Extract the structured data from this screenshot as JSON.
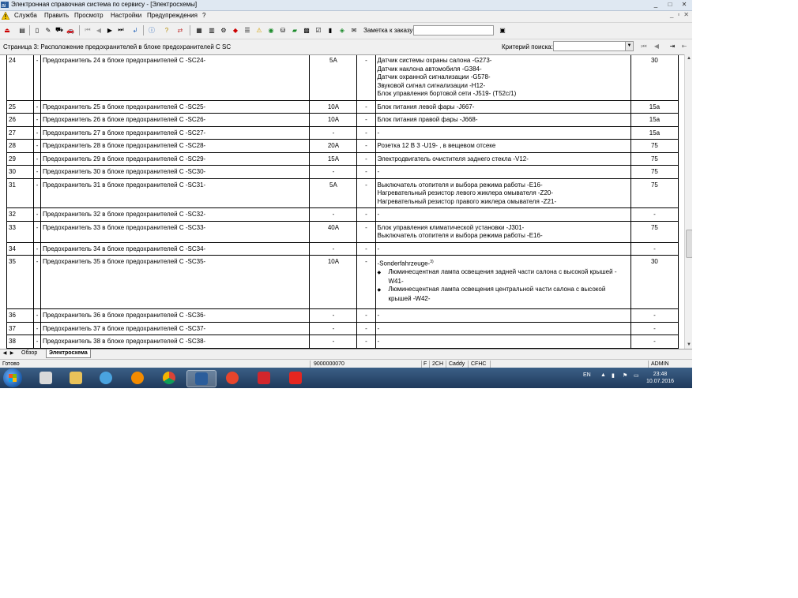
{
  "window": {
    "title": "Электронная справочная система по сервису - [Электросхемы]"
  },
  "menu": {
    "items": [
      "Служба",
      "Править",
      "Просмотр",
      "Настройки",
      "Предупреждения",
      "?"
    ]
  },
  "toolbar": {
    "order_note_label": "Заметка к заказу:",
    "order_note_value": ""
  },
  "page": {
    "title": "Страница 3: Расположение предохранителей в блоке предохранителей С SC",
    "search_label": "Критерий поиска:",
    "search_value": ""
  },
  "table": {
    "rows": [
      {
        "num": "24",
        "dash": "-",
        "name": "Предохранитель 24 в блоке предохранителей С -SC24-",
        "amp": "5A",
        "dash2": "-",
        "desc": [
          "Датчик системы охраны салона -G273-",
          "Датчик наклона автомобиля -G384-",
          "Датчик охранной сигнализации -G578-",
          "Звуковой сигнал сигнализации -H12-",
          "Блок управления бортовой сети -J519- (T52c/1)"
        ],
        "col": "30"
      },
      {
        "num": "25",
        "dash": "-",
        "name": "Предохранитель 25 в блоке предохранителей С -SC25-",
        "amp": "10A",
        "dash2": "-",
        "desc": [
          "Блок питания левой фары -J667-"
        ],
        "col": "15a"
      },
      {
        "num": "26",
        "dash": "-",
        "name": "Предохранитель 26 в блоке предохранителей С -SC26-",
        "amp": "10A",
        "dash2": "-",
        "desc": [
          "Блок питания правой фары -J668-"
        ],
        "col": "15a"
      },
      {
        "num": "27",
        "dash": "-",
        "name": "Предохранитель 27 в блоке предохранителей С -SC27-",
        "amp": "-",
        "dash2": "-",
        "desc": [
          "-"
        ],
        "col": "15a"
      },
      {
        "num": "28",
        "dash": "-",
        "name": "Предохранитель 28 в блоке предохранителей С -SC28-",
        "amp": "20A",
        "dash2": "-",
        "desc": [
          "Розетка 12 В 3 -U19- , в вещевом отсеке"
        ],
        "col": "75"
      },
      {
        "num": "29",
        "dash": "-",
        "name": "Предохранитель 29 в блоке предохранителей С -SC29-",
        "amp": "15A",
        "dash2": "-",
        "desc": [
          "Электродвигатель очистителя заднего стекла -V12-"
        ],
        "col": "75"
      },
      {
        "num": "30",
        "dash": "-",
        "name": "Предохранитель 30 в блоке предохранителей С -SC30-",
        "amp": "-",
        "dash2": "-",
        "desc": [
          "-"
        ],
        "col": "75"
      },
      {
        "num": "31",
        "dash": "-",
        "name": "Предохранитель 31 в блоке предохранителей С -SC31-",
        "amp": "5A",
        "dash2": "-",
        "desc": [
          "Выключатель отопителя и выбора режима работы -E16-",
          "Нагревательный резистор левого жиклера омывателя -Z20-",
          "Нагревательный резистор правого жиклера омывателя -Z21-"
        ],
        "col": "75"
      },
      {
        "num": "32",
        "dash": "-",
        "name": "Предохранитель 32 в блоке предохранителей С -SC32-",
        "amp": "-",
        "dash2": "-",
        "desc": [
          "-"
        ],
        "col": "-"
      },
      {
        "num": "33",
        "dash": "-",
        "name": "Предохранитель 33 в блоке предохранителей С -SC33-",
        "amp": "40A",
        "dash2": "-",
        "desc": [
          "Блок управления климатической установки -J301-",
          "Выключатель отопителя и выбора режима работы -E16-"
        ],
        "col": "75"
      },
      {
        "num": "34",
        "dash": "-",
        "name": "Предохранитель 34 в блоке предохранителей С -SC34-",
        "amp": "-",
        "dash2": "-",
        "desc": [
          "-"
        ],
        "col": "-"
      },
      {
        "num": "35",
        "dash": "-",
        "name": "Предохранитель 35 в блоке предохранителей С -SC35-",
        "amp": "10A",
        "dash2": "-",
        "desc_heading": "-Sonderfahrzeuge-",
        "desc_heading_sup": "3)",
        "desc_bullets": [
          "Люминесцентная лампа освещения задней части салона с высокой крышей -W41-",
          "Люминесцентная лампа освещения центральной части салона с высокой крышей -W42-"
        ],
        "col": "30"
      },
      {
        "num": "36",
        "dash": "-",
        "name": "Предохранитель 36 в блоке предохранителей С -SC36-",
        "amp": "-",
        "dash2": "-",
        "desc": [
          "-"
        ],
        "col": "-"
      },
      {
        "num": "37",
        "dash": "-",
        "name": "Предохранитель 37 в блоке предохранителей С -SC37-",
        "amp": "-",
        "dash2": "-",
        "desc": [
          "-"
        ],
        "col": "-"
      },
      {
        "num": "38",
        "dash": "-",
        "name": "Предохранитель 38 в блоке предохранителей С -SC38-",
        "amp": "-",
        "dash2": "-",
        "desc": [
          "-"
        ],
        "col": "-"
      }
    ]
  },
  "tabs": [
    "Обзор",
    "Электросхема"
  ],
  "status": {
    "ready": "Готово",
    "code": "9000000070",
    "f": "F",
    "model_code": "2CH",
    "model": "Caddy",
    "engine": "CFHC",
    "user": "ADMIN"
  },
  "taskbar": {
    "lang": "EN",
    "time": "23:48",
    "date": "10.07.2016"
  },
  "colors": {
    "titlebar": "#dfe8f2",
    "taskbar": "#2a4a70",
    "toolbar": "#f0f0f0"
  }
}
